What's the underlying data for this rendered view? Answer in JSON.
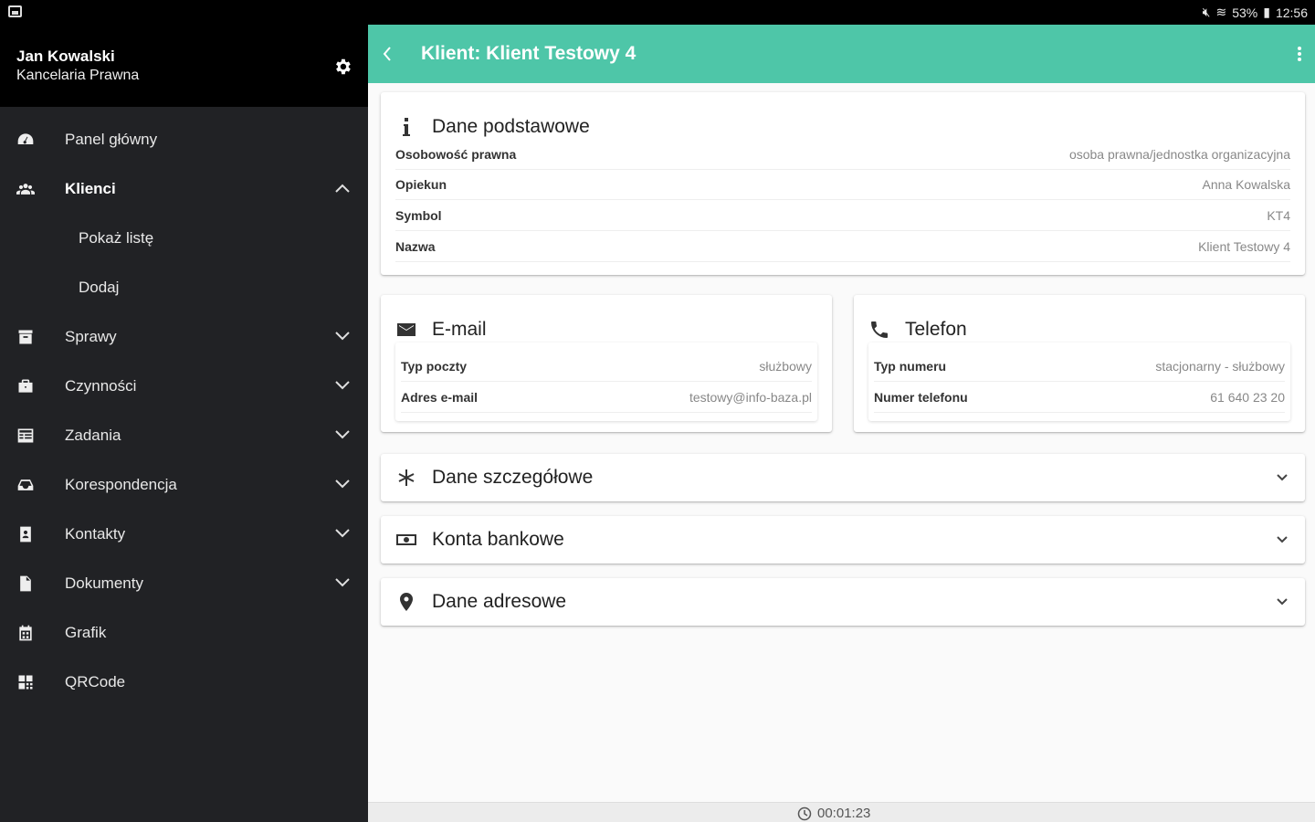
{
  "statusbar": {
    "battery": "53%",
    "time": "12:56"
  },
  "drawer": {
    "user_name": "Jan Kowalski",
    "user_org": "Kancelaria Prawna",
    "items": [
      {
        "label": "Panel główny",
        "icon": "dashboard-icon"
      },
      {
        "label": "Klienci",
        "icon": "people-icon",
        "expanded": true
      },
      {
        "label": "Pokaż listę",
        "sub": true
      },
      {
        "label": "Dodaj",
        "sub": true
      },
      {
        "label": "Sprawy",
        "icon": "archive-icon"
      },
      {
        "label": "Czynności",
        "icon": "briefcase-icon"
      },
      {
        "label": "Zadania",
        "icon": "list-icon"
      },
      {
        "label": "Korespondencja",
        "icon": "inbox-icon"
      },
      {
        "label": "Kontakty",
        "icon": "contact-icon"
      },
      {
        "label": "Dokumenty",
        "icon": "document-icon"
      },
      {
        "label": "Grafik",
        "icon": "calendar-icon"
      },
      {
        "label": "QRCode",
        "icon": "qrcode-icon"
      }
    ]
  },
  "appbar": {
    "title": "Klient: Klient Testowy 4"
  },
  "basic": {
    "title": "Dane podstawowe",
    "rows": [
      {
        "k": "Osobowość prawna",
        "v": "osoba prawna/jednostka organizacyjna"
      },
      {
        "k": "Opiekun",
        "v": "Anna Kowalska"
      },
      {
        "k": "Symbol",
        "v": "KT4"
      },
      {
        "k": "Nazwa",
        "v": "Klient Testowy 4"
      }
    ]
  },
  "email": {
    "title": "E-mail",
    "rows": [
      {
        "k": "Typ poczty",
        "v": "służbowy"
      },
      {
        "k": "Adres e-mail",
        "v": "testowy@info-baza.pl"
      }
    ]
  },
  "phone": {
    "title": "Telefon",
    "rows": [
      {
        "k": "Typ numeru",
        "v": "stacjonarny - służbowy"
      },
      {
        "k": "Numer telefonu",
        "v": "61 640 23 20"
      }
    ]
  },
  "sections": {
    "details": "Dane szczegółowe",
    "bank": "Konta bankowe",
    "address": "Dane adresowe"
  },
  "footer": {
    "timer": "00:01:23"
  },
  "colors": {
    "accent": "#4ec6a8",
    "drawer": "#212225"
  }
}
